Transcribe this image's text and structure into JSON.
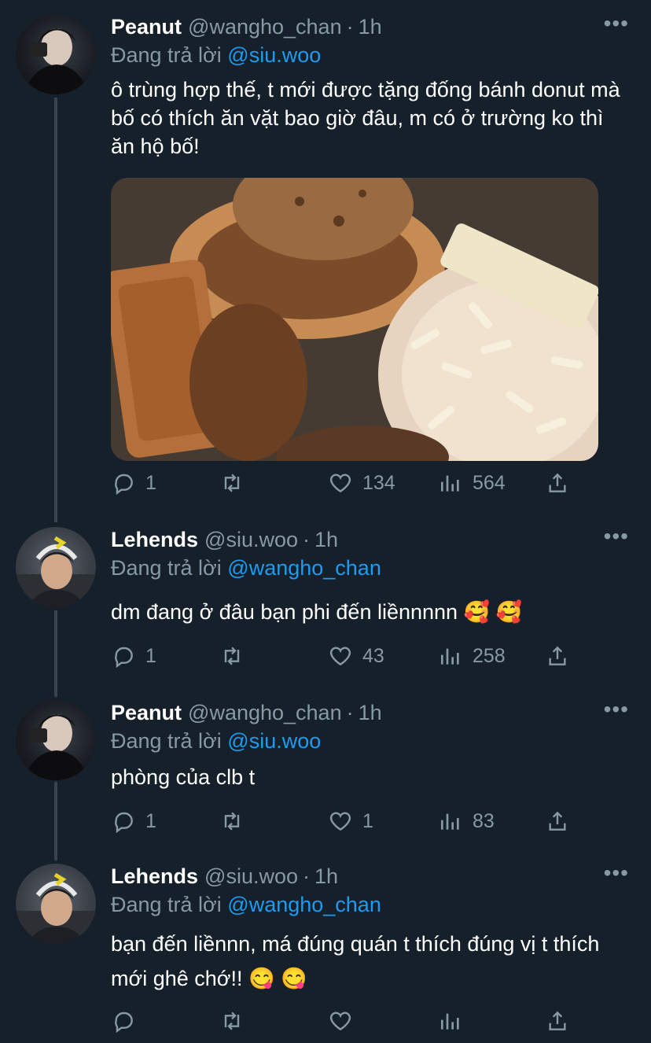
{
  "tweets": [
    {
      "name": "Peanut",
      "handle": "@wangho_chan",
      "time": "1h",
      "reply_prefix": "Đang trả lời",
      "reply_to": "@siu.woo",
      "text": "ô trùng hợp thế, t mới được tặng đống bánh donut mà bố có thích ăn vặt bao giờ đâu, m có ở trường ko thì ăn hộ bố!",
      "counts": {
        "replies": "1",
        "retweets": "",
        "likes": "134",
        "views": "564"
      }
    },
    {
      "name": "Lehends",
      "handle": "@siu.woo",
      "time": "1h",
      "reply_prefix": "Đang trả lời",
      "reply_to": "@wangho_chan",
      "text": "dm đang ở đâu bạn phi đến liềnnnnn 🥰 🥰",
      "counts": {
        "replies": "1",
        "retweets": "",
        "likes": "43",
        "views": "258"
      }
    },
    {
      "name": "Peanut",
      "handle": "@wangho_chan",
      "time": "1h",
      "reply_prefix": "Đang trả lời",
      "reply_to": "@siu.woo",
      "text": "phòng của clb t",
      "counts": {
        "replies": "1",
        "retweets": "",
        "likes": "1",
        "views": "83"
      }
    },
    {
      "name": "Lehends",
      "handle": "@siu.woo",
      "time": "1h",
      "reply_prefix": "Đang trả lời",
      "reply_to": "@wangho_chan",
      "text": "bạn đến liềnnn, má đúng quán t thích đúng vị t thích mới ghê chớ!! 😋 😋",
      "counts": {
        "replies": "",
        "retweets": "",
        "likes": "",
        "views": ""
      }
    }
  ],
  "more_label": "•••",
  "colors": {
    "background": "#15202b",
    "accent": "#1d9bf0",
    "muted": "#8899a6",
    "thread_line": "#38444d"
  },
  "icons": [
    "reply-icon",
    "retweet-icon",
    "like-icon",
    "views-icon",
    "share-icon",
    "more-icon"
  ]
}
